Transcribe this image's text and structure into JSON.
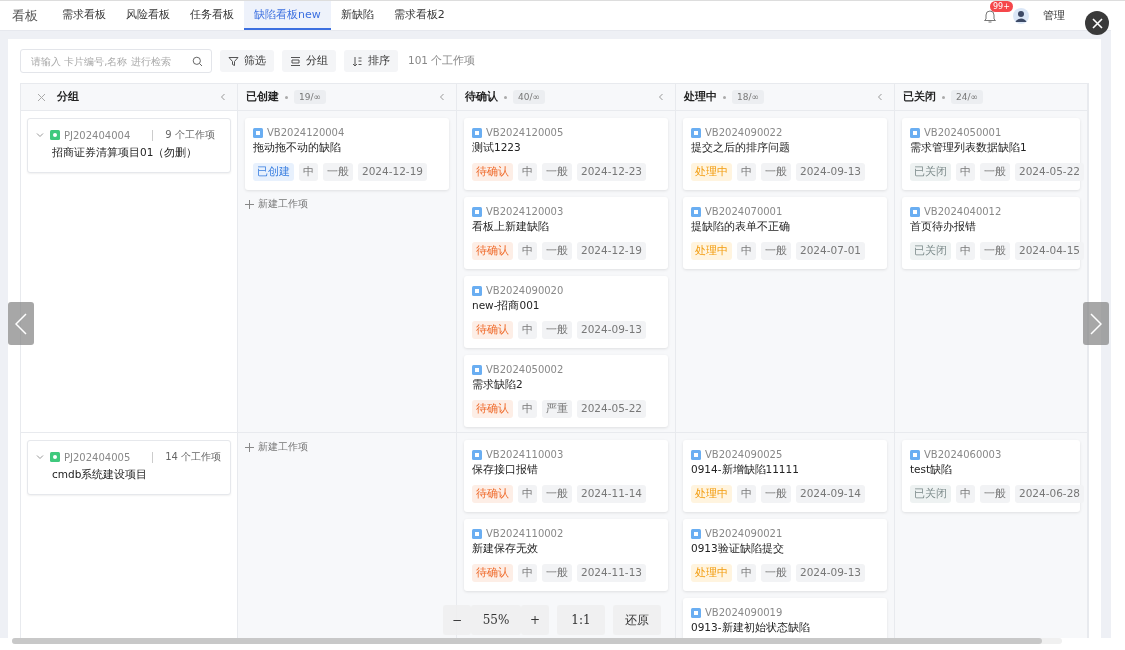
{
  "nav": {
    "title": "看板",
    "tabs": [
      {
        "label": "需求看板",
        "selected": false
      },
      {
        "label": "风险看板",
        "selected": false
      },
      {
        "label": "任务看板",
        "selected": false
      },
      {
        "label": "缺陷看板new",
        "selected": true
      },
      {
        "label": "新缺陷",
        "selected": false
      },
      {
        "label": "需求看板2",
        "selected": false
      }
    ],
    "notifications": "99+",
    "user": "管理"
  },
  "toolbar": {
    "search_placeholder": "请输入 卡片编号,名称 进行检索",
    "buttons": [
      {
        "kind": "filter",
        "label": "筛选"
      },
      {
        "kind": "group",
        "label": "分组"
      },
      {
        "kind": "sort",
        "label": "排序"
      }
    ],
    "count": "101 个工作项"
  },
  "board": {
    "group_header": "分组",
    "columns": [
      {
        "title": "已创建",
        "count": "19/∞",
        "collapsible": true
      },
      {
        "title": "待确认",
        "count": "40/∞",
        "collapsible": true
      },
      {
        "title": "处理中",
        "count": "18/∞",
        "collapsible": true
      },
      {
        "title": "已关闭",
        "count": "24/∞",
        "collapsible": false
      }
    ],
    "rows": [
      {
        "group": {
          "id": "PJ202404004",
          "count": "9 个工作项",
          "name": "招商证券清算项目01（勿删）",
          "expanded": true
        },
        "cells": [
          {
            "cards": [
              {
                "id": "VB2024120004",
                "title": "拖动拖不动的缺陷",
                "status": {
                  "label": "已创建",
                  "kind": "created"
                },
                "priority": "中",
                "severity": "一般",
                "date": "2024-12-19"
              }
            ],
            "add_label": "新建工作项"
          },
          {
            "cards": [
              {
                "id": "VB2024120005",
                "title": "测试1223",
                "status": {
                  "label": "待确认",
                  "kind": "pending"
                },
                "priority": "中",
                "severity": "一般",
                "date": "2024-12-23"
              },
              {
                "id": "VB2024120003",
                "title": "看板上新建缺陷",
                "status": {
                  "label": "待确认",
                  "kind": "pending"
                },
                "priority": "中",
                "severity": "一般",
                "date": "2024-12-19"
              },
              {
                "id": "VB2024090020",
                "title": "new-招商001",
                "status": {
                  "label": "待确认",
                  "kind": "pending"
                },
                "priority": "中",
                "severity": "一般",
                "date": "2024-09-13"
              },
              {
                "id": "VB2024050002",
                "title": "需求缺陷2",
                "status": {
                  "label": "待确认",
                  "kind": "pending"
                },
                "priority": "中",
                "severity": "严重",
                "date": "2024-05-22"
              }
            ]
          },
          {
            "cards": [
              {
                "id": "VB2024090022",
                "title": "提交之后的排序问题",
                "status": {
                  "label": "处理中",
                  "kind": "processing"
                },
                "priority": "中",
                "severity": "一般",
                "date": "2024-09-13"
              },
              {
                "id": "VB2024070001",
                "title": "提缺陷的表单不正确",
                "status": {
                  "label": "处理中",
                  "kind": "processing"
                },
                "priority": "中",
                "severity": "一般",
                "date": "2024-07-01"
              }
            ]
          },
          {
            "cards": [
              {
                "id": "VB2024050001",
                "title": "需求管理列表数据缺陷1",
                "status": {
                  "label": "已关闭",
                  "kind": "closed"
                },
                "priority": "中",
                "severity": "一般",
                "date": "2024-05-22"
              },
              {
                "id": "VB2024040012",
                "title": "首页待办报错",
                "status": {
                  "label": "已关闭",
                  "kind": "closed"
                },
                "priority": "中",
                "severity": "一般",
                "date": "2024-04-15"
              }
            ]
          }
        ]
      },
      {
        "group": {
          "id": "PJ202404005",
          "count": "14 个工作项",
          "name": "cmdb系统建设项目",
          "expanded": true
        },
        "cells": [
          {
            "add_label": "新建工作项"
          },
          {
            "cards": [
              {
                "id": "VB2024110003",
                "title": "保存接口报错",
                "status": {
                  "label": "待确认",
                  "kind": "pending"
                },
                "priority": "中",
                "severity": "一般",
                "date": "2024-11-14"
              },
              {
                "id": "VB2024110002",
                "title": "新建保存无效",
                "status": {
                  "label": "待确认",
                  "kind": "pending"
                },
                "priority": "中",
                "severity": "一般",
                "date": "2024-11-13"
              }
            ]
          },
          {
            "cards": [
              {
                "id": "VB2024090025",
                "title": "0914-新增缺陷11111",
                "status": {
                  "label": "处理中",
                  "kind": "processing"
                },
                "priority": "中",
                "severity": "一般",
                "date": "2024-09-14"
              },
              {
                "id": "VB2024090021",
                "title": "0913验证缺陷提交",
                "status": {
                  "label": "处理中",
                  "kind": "processing"
                },
                "priority": "中",
                "severity": "一般",
                "date": "2024-09-13"
              },
              {
                "id": "VB2024090019",
                "title": "0913-新建初始状态缺陷"
              }
            ]
          },
          {
            "cards": [
              {
                "id": "VB2024060003",
                "title": "test缺陷",
                "status": {
                  "label": "已关闭",
                  "kind": "closed"
                },
                "priority": "中",
                "severity": "一般",
                "date": "2024-06-28"
              }
            ]
          }
        ]
      }
    ]
  },
  "viewer": {
    "zoom_out": "−",
    "zoom": "55%",
    "zoom_in": "+",
    "actual_size": "1:1",
    "reset": "还原"
  }
}
